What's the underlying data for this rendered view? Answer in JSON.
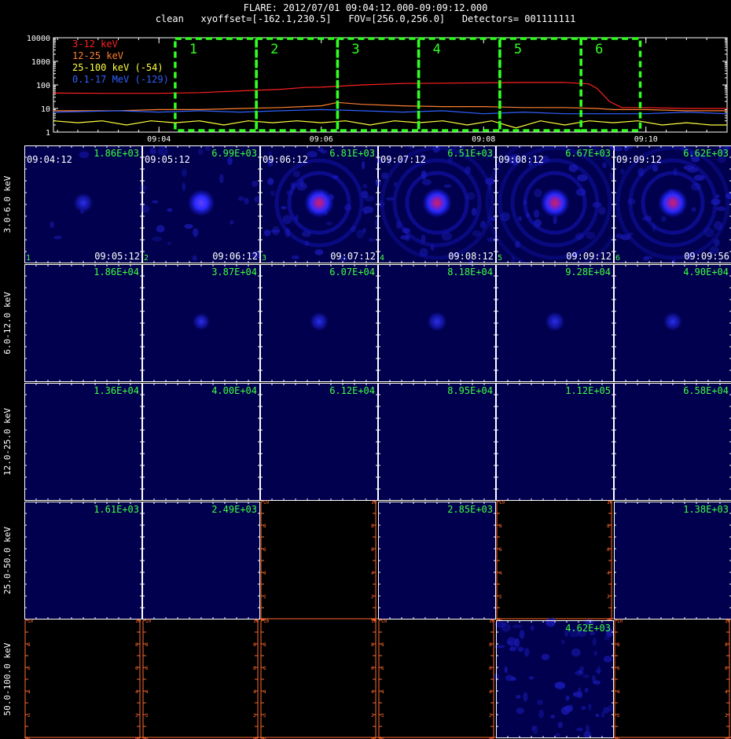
{
  "title": {
    "line1": "FLARE: 2012/07/01 09:04:12.000-09:09:12.000",
    "line2": "clean   xyoffset=[-162.1,230.5]   FOV=[256.0,256.0]   Detectors= 001111111"
  },
  "chart_data": [
    {
      "type": "line",
      "yscale": "log",
      "ylim": [
        1,
        10000
      ],
      "y_ticks": [
        "10000",
        "1000",
        "100",
        "10",
        "1"
      ],
      "x_ticks": [
        "09:04",
        "09:06",
        "09:08",
        "09:10"
      ],
      "x_tick_minutes": [
        4,
        6,
        8,
        10
      ],
      "xlim_minutes": [
        2.7,
        11.0
      ],
      "legend_position": "top-left",
      "series": [
        {
          "name": "3-12 keV",
          "color": "#ff2020",
          "x": [
            2.7,
            3.3,
            4.0,
            4.5,
            5.0,
            5.5,
            5.8,
            6.0,
            6.5,
            7.0,
            7.5,
            8.0,
            8.5,
            9.0,
            9.3,
            9.4,
            9.55,
            9.7,
            10.0,
            10.5,
            11.0
          ],
          "y": [
            45,
            44,
            44,
            47,
            56,
            65,
            78,
            80,
            100,
            115,
            118,
            123,
            127,
            128,
            110,
            70,
            20,
            11,
            11,
            10,
            10
          ]
        },
        {
          "name": "12-25 keV",
          "color": "#ff7f30",
          "x": [
            2.7,
            3.5,
            4.0,
            4.5,
            5.0,
            5.5,
            6.0,
            6.2,
            6.5,
            7.0,
            7.5,
            8.0,
            8.5,
            9.0,
            9.4,
            9.6,
            10.0,
            10.5,
            11.0
          ],
          "y": [
            8,
            8,
            9,
            9,
            10,
            11,
            13,
            18,
            15,
            13,
            12,
            12,
            11,
            11,
            10,
            9,
            9,
            8,
            8
          ]
        },
        {
          "name": "25-100 keV (-54)",
          "color": "#ffff40",
          "x": [
            2.7,
            3.0,
            3.3,
            3.6,
            3.9,
            4.2,
            4.5,
            4.8,
            5.1,
            5.4,
            5.7,
            6.0,
            6.3,
            6.6,
            6.9,
            7.2,
            7.5,
            7.8,
            8.1,
            8.4,
            8.7,
            9.0,
            9.3,
            9.6,
            9.9,
            10.2,
            10.5,
            10.8,
            11.0
          ],
          "y": [
            3,
            2.5,
            3,
            2,
            3,
            2.5,
            3,
            2,
            3,
            2.5,
            3,
            2.5,
            3,
            2,
            3,
            2.5,
            3,
            2,
            3,
            1.5,
            3,
            2,
            3,
            2.5,
            3,
            2,
            2.5,
            2,
            2
          ]
        },
        {
          "name": "0.1-17 MeV (-129)",
          "color": "#3060ff",
          "x": [
            2.7,
            3.5,
            4.0,
            4.5,
            5.0,
            5.5,
            6.0,
            6.5,
            7.0,
            7.5,
            8.0,
            8.5,
            9.0,
            9.5,
            10.0,
            10.5,
            11.0
          ],
          "y": [
            7,
            8,
            7,
            8,
            7,
            8,
            9,
            8,
            7,
            8,
            6,
            7,
            6,
            6,
            6,
            7,
            6
          ]
        }
      ],
      "intervals": [
        {
          "label": "1",
          "start_min": 4.2,
          "end_min": 5.2
        },
        {
          "label": "2",
          "start_min": 5.2,
          "end_min": 6.2
        },
        {
          "label": "3",
          "start_min": 6.2,
          "end_min": 7.2
        },
        {
          "label": "4",
          "start_min": 7.2,
          "end_min": 8.2
        },
        {
          "label": "5",
          "start_min": 8.2,
          "end_min": 9.2
        },
        {
          "label": "6",
          "start_min": 9.2,
          "end_min": 9.93
        }
      ]
    },
    {
      "type": "heatmap",
      "rows": [
        {
          "label": "3.0-6.0 keV"
        },
        {
          "label": "6.0-12.0 keV"
        },
        {
          "label": "12.0-25.0 keV"
        },
        {
          "label": "25.0-50.0 keV"
        },
        {
          "label": "50.0-100.0 keV"
        }
      ],
      "columns": [
        {
          "number": "1",
          "start": "09:04:12",
          "end": "09:05:12"
        },
        {
          "number": "2",
          "start": "09:05:12",
          "end": "09:06:12"
        },
        {
          "number": "3",
          "start": "09:06:12",
          "end": "09:07:12"
        },
        {
          "number": "4",
          "start": "09:07:12",
          "end": "09:08:12"
        },
        {
          "number": "5",
          "start": "09:08:12",
          "end": "09:09:12"
        },
        {
          "number": "6",
          "start": "09:09:12",
          "end": "09:09:56"
        }
      ],
      "panel_axis_ticks": [
        "0",
        "2",
        "4",
        "6",
        "8",
        "10"
      ],
      "cells": [
        [
          {
            "max": "1.86E+03",
            "kind": "source",
            "strength": 0.5,
            "rings": 0,
            "noise": 0.05
          },
          {
            "max": "6.99E+03",
            "kind": "source",
            "strength": 0.85,
            "rings": 0,
            "noise": 0.35
          },
          {
            "max": "6.81E+03",
            "kind": "source",
            "strength": 1.0,
            "rings": 2,
            "noise": 0.6
          },
          {
            "max": "6.51E+03",
            "kind": "source",
            "strength": 1.0,
            "rings": 3,
            "noise": 0.5
          },
          {
            "max": "6.67E+03",
            "kind": "source",
            "strength": 1.0,
            "rings": 4,
            "noise": 0.45
          },
          {
            "max": "6.62E+03",
            "kind": "source",
            "strength": 1.0,
            "rings": 3,
            "noise": 0.55
          }
        ],
        [
          {
            "max": "1.86E+04",
            "kind": "empty",
            "strength": 0,
            "rings": 0,
            "noise": 0
          },
          {
            "max": "3.87E+04",
            "kind": "source",
            "strength": 0.35,
            "rings": 0,
            "noise": 0
          },
          {
            "max": "6.07E+04",
            "kind": "source",
            "strength": 0.45,
            "rings": 0,
            "noise": 0
          },
          {
            "max": "8.18E+04",
            "kind": "source",
            "strength": 0.5,
            "rings": 0,
            "noise": 0
          },
          {
            "max": "9.28E+04",
            "kind": "source",
            "strength": 0.5,
            "rings": 0,
            "noise": 0
          },
          {
            "max": "4.90E+04",
            "kind": "source",
            "strength": 0.45,
            "rings": 0,
            "noise": 0
          }
        ],
        [
          {
            "max": "1.36E+04",
            "kind": "empty",
            "strength": 0,
            "rings": 0,
            "noise": 0
          },
          {
            "max": "4.00E+04",
            "kind": "empty",
            "strength": 0,
            "rings": 0,
            "noise": 0
          },
          {
            "max": "6.12E+04",
            "kind": "empty",
            "strength": 0,
            "rings": 0,
            "noise": 0
          },
          {
            "max": "8.95E+04",
            "kind": "empty",
            "strength": 0,
            "rings": 0,
            "noise": 0
          },
          {
            "max": "1.12E+05",
            "kind": "empty",
            "strength": 0,
            "rings": 0,
            "noise": 0
          },
          {
            "max": "6.58E+04",
            "kind": "empty",
            "strength": 0,
            "rings": 0,
            "noise": 0
          }
        ],
        [
          {
            "max": "1.61E+03",
            "kind": "empty",
            "strength": 0,
            "rings": 0,
            "noise": 0
          },
          {
            "max": "2.49E+03",
            "kind": "empty",
            "strength": 0,
            "rings": 0,
            "noise": 0
          },
          {
            "max": "",
            "kind": "blank",
            "strength": 0,
            "rings": 0,
            "noise": 0
          },
          {
            "max": "2.85E+03",
            "kind": "empty",
            "strength": 0,
            "rings": 0,
            "noise": 0
          },
          {
            "max": "",
            "kind": "blank",
            "strength": 0,
            "rings": 0,
            "noise": 0
          },
          {
            "max": "1.38E+03",
            "kind": "empty",
            "strength": 0,
            "rings": 0,
            "noise": 0
          }
        ],
        [
          {
            "max": "",
            "kind": "blank",
            "strength": 0,
            "rings": 0,
            "noise": 0
          },
          {
            "max": "",
            "kind": "blank",
            "strength": 0,
            "rings": 0,
            "noise": 0
          },
          {
            "max": "",
            "kind": "blank",
            "strength": 0,
            "rings": 0,
            "noise": 0
          },
          {
            "max": "",
            "kind": "blank",
            "strength": 0,
            "rings": 0,
            "noise": 0
          },
          {
            "max": "4.62E+03",
            "kind": "noise",
            "strength": 0,
            "rings": 0,
            "noise": 1.0
          },
          {
            "max": "",
            "kind": "blank",
            "strength": 0,
            "rings": 0,
            "noise": 0
          }
        ]
      ]
    }
  ],
  "colors": {
    "text": "#ffffff",
    "max_label": "#40ff40",
    "interval_box": "#30ff20",
    "blank_axis": "#ff6a30",
    "panel_bg": "#00004e",
    "panel_border": "#ffffff"
  }
}
